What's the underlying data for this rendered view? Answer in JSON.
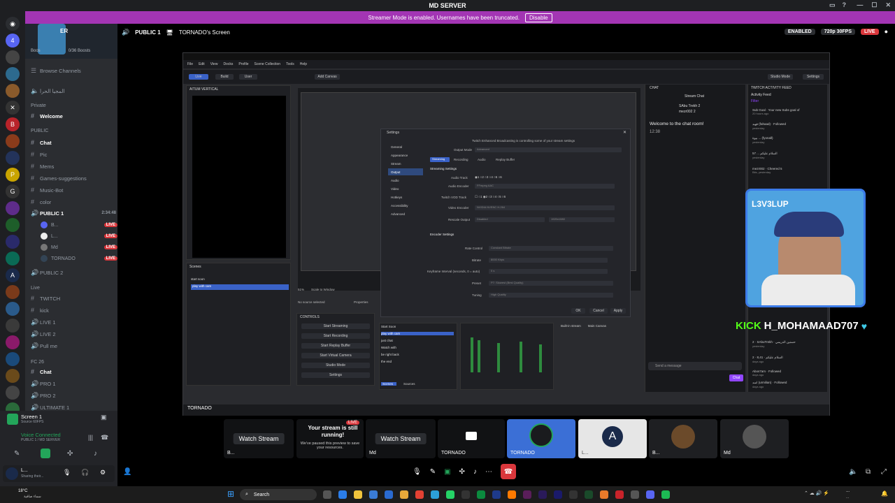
{
  "window": {
    "title": "MD SERVER"
  },
  "banner": {
    "text": "Streamer Mode is enabled. Usernames have been truncated.",
    "action": "Disable"
  },
  "sidebar": {
    "server_name": "ER",
    "boosts": {
      "left": "Boos",
      "right": "0/36 Boosts"
    },
    "browse": "Browse Channels",
    "top_channel": "المجيا الحرا",
    "categories": {
      "private": "Private",
      "public": "PUBLIC",
      "live": "Live",
      "fc": "FC 26"
    },
    "channels": {
      "welcome": "Welcome",
      "chat": "Chat",
      "pic": "Pic",
      "mems": "Mems",
      "games": "Games-suggestions",
      "music": "Music-Bot",
      "color": "color",
      "public1": "PUBLIC 1",
      "public1_time": "2:34:48",
      "public2": "PUBLIC 2",
      "twitch": "TWITCH",
      "kick": "kick",
      "live1": "LIVE 1",
      "live2": "LIVE 2",
      "pullme": "Pull me",
      "fc_chat": "Chat",
      "pro1": "PRO 1",
      "pro2": "PRO 2",
      "ultimate": "ULTIMATE 1"
    },
    "voice_users": [
      "B...",
      "L...",
      "Md",
      "TORNADO"
    ],
    "live_label": "LIVE"
  },
  "voice_panel": {
    "screen": "Screen 1",
    "screen_sub": "Source 60FPS",
    "connected": "Voice Connected",
    "connected_sub": "PUBLIC 1 / MD SERVER",
    "user": "L...",
    "user_status": "Sharing their..."
  },
  "header": {
    "channel": "PUBLIC 1",
    "screen": "TORNADO's Screen",
    "enabled": "ENABLED",
    "quality": "720p 30FPS",
    "live": "LIVE"
  },
  "obs": {
    "menu": [
      "File",
      "Edit",
      "View",
      "Docks",
      "Profile",
      "Scene Collection",
      "Tools",
      "Help"
    ],
    "toolbar": [
      "Live",
      "Build",
      "User",
      "Add Canvas"
    ],
    "right_toolbar": [
      "Studio Mode",
      "Settings"
    ],
    "vertical_title": "AITUM VERTICAL",
    "scenes_title": "Scenes",
    "scenes": [
      "start soon",
      "play with cam"
    ],
    "no_source": "No source selected",
    "properties": "Properties",
    "controls_title": "CONTROLS",
    "controls": [
      "Start Streaming",
      "Start Recording",
      "Start Replay Buffer",
      "Start Virtual Camera",
      "Studio Mode",
      "Settings"
    ],
    "inner_scenes": [
      "Start Soon",
      "play with cam",
      "just chat",
      "Watch with",
      "be right back",
      "the end"
    ],
    "scale": "Scale to Window",
    "zoom": "51%",
    "sources_tab": "Sources",
    "scenes_tab": "Scenes",
    "chat_tab": "Built-in stream",
    "main_canvas": "Main Canvas"
  },
  "settings": {
    "title": "Settings",
    "nav": [
      "General",
      "Appearance",
      "Stream",
      "Output",
      "Audio",
      "Video",
      "Hotkeys",
      "Accessibility",
      "Advanced"
    ],
    "notice": "Twitch Enhanced Broadcasting is controlling some of your stream settings",
    "output_mode_label": "Output Mode",
    "output_mode": "Advanced",
    "tabs": [
      "Streaming",
      "Recording",
      "Audio",
      "Replay Buffer"
    ],
    "section_streaming": "Streaming Settings",
    "audio_track": "Audio Track",
    "audio_encoder": "Audio Encoder",
    "audio_encoder_val": "FFmpeg AAC",
    "vod_track": "Twitch VOD Track",
    "video_encoder": "Video Encoder",
    "video_encoder_val": "NVIDIA NVENC H.264",
    "rescale": "Rescale Output",
    "rescale_val": "Disabled",
    "rescale_res": "1920x1080",
    "section_encoder": "Encoder Settings",
    "rate_control": "Rate Control",
    "rate_control_val": "Constant Bitrate",
    "bitrate": "Bitrate",
    "bitrate_val": "8000 Kbps",
    "keyframe": "Keyframe Interval (seconds, 0 = auto)",
    "keyframe_val": "0 s",
    "preset": "Preset",
    "preset_val": "P7: Slowest (Best Quality)",
    "tuning": "Tuning",
    "tuning_val": "High Quality",
    "ok": "OK",
    "cancel": "Cancel",
    "apply": "Apply"
  },
  "chat": {
    "title": "CHAT",
    "subtitle": "Stream Chat",
    "welcome": "Welcome to the chat room!",
    "time": "12:38",
    "send_placeholder": "Send a message",
    "chat_button": "Chat",
    "top_users": [
      "SAbu Trekh 2",
      "mezr002 2"
    ]
  },
  "activity": {
    "title": "TWITCH ACTIVITY FEED",
    "subtitle": "Activity Feed",
    "filter": "Filter",
    "items": [
      {
        "text": "Sub Goal · Your new Subs goal of",
        "sub": "20 hours ago"
      },
      {
        "text": "فهيد (fahaad) · Followed",
        "sub": "yesterday"
      },
      {
        "text": "بيوة ... (fyonall)",
        "sub": "yesterday"
      },
      {
        "text": "السلام عليكم ... 57",
        "sub": "yesterday"
      },
      {
        "text": "mezr002 · Cheered 5",
        "sub": "Bits, yesterday"
      },
      {
        "text": "2 · SAbuTrekh · حسنين الدريمي",
        "sub": "yesterday"
      },
      {
        "text": "2 · 8,41 · السلام عليكم",
        "sub": "days ago"
      },
      {
        "text": "Abos7am · Followed",
        "sub": "days ago"
      },
      {
        "text": "اسد (urmilian) · Followed",
        "sub": "days ago"
      }
    ]
  },
  "webcam": {
    "label": "L3V3LUP"
  },
  "kick_overlay": {
    "brand": "KICK",
    "handle": "H_MOHAMAAD707"
  },
  "tiles": [
    {
      "watch": "Watch Stream",
      "name": "B..."
    },
    {
      "title": "Your stream is still running!",
      "body": "We've paused this preview to save your resources.",
      "name": "B..."
    },
    {
      "watch": "Watch Stream",
      "name": "Md"
    },
    {
      "name": "TORNADO"
    },
    {
      "name": "TORNADO"
    },
    {
      "name": "L..."
    },
    {
      "name": "B..."
    },
    {
      "name": "Md"
    }
  ],
  "live_badge": "LIVE",
  "taskbar": {
    "weather_temp": "18°C",
    "weather_desc": "سماء صافية",
    "search": "Search",
    "time": "...",
    "date": "..."
  },
  "colors": {
    "banner": "#a335b4",
    "live": "#da373c",
    "accent": "#5865f2",
    "kick": "#53fc18"
  }
}
